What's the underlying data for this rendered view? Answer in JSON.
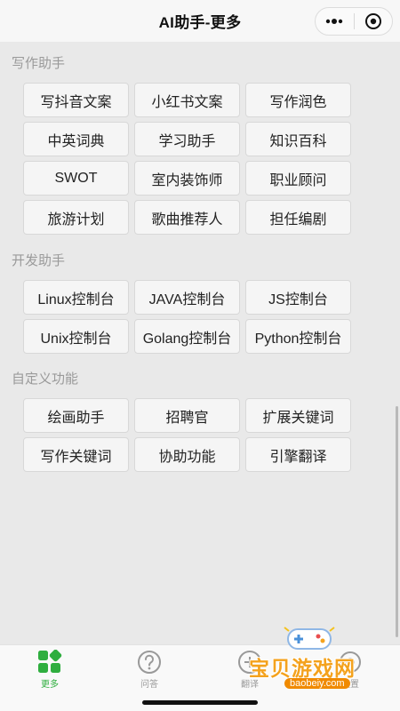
{
  "header": {
    "title": "AI助手-更多"
  },
  "sections": [
    {
      "title": "写作助手",
      "items": [
        "写抖音文案",
        "小红书文案",
        "写作润色",
        "中英词典",
        "学习助手",
        "知识百科",
        "SWOT",
        "室内装饰师",
        "职业顾问",
        "旅游计划",
        "歌曲推荐人",
        "担任编剧"
      ]
    },
    {
      "title": "开发助手",
      "items": [
        "Linux控制台",
        "JAVA控制台",
        "JS控制台",
        "Unix控制台",
        "Golang控制台",
        "Python控制台"
      ]
    },
    {
      "title": "自定义功能",
      "items": [
        "绘画助手",
        "招聘官",
        "扩展关键词",
        "写作关键词",
        "协助功能",
        "引擎翻译"
      ]
    }
  ],
  "tabbar": {
    "items": [
      {
        "label": "更多",
        "icon": "grid-icon",
        "active": true
      },
      {
        "label": "问答",
        "icon": "question-icon",
        "active": false
      },
      {
        "label": "翻译",
        "icon": "translate-icon",
        "active": false
      },
      {
        "label": "设置",
        "icon": "settings-icon",
        "active": false
      }
    ]
  },
  "watermark": {
    "text": "宝贝游戏网",
    "url": "baobeiy.com"
  },
  "colors": {
    "accent": "#2fae3f",
    "page_bg": "#e9e9e9",
    "button_bg": "#f5f5f5",
    "section_title": "#9a9a9a"
  }
}
